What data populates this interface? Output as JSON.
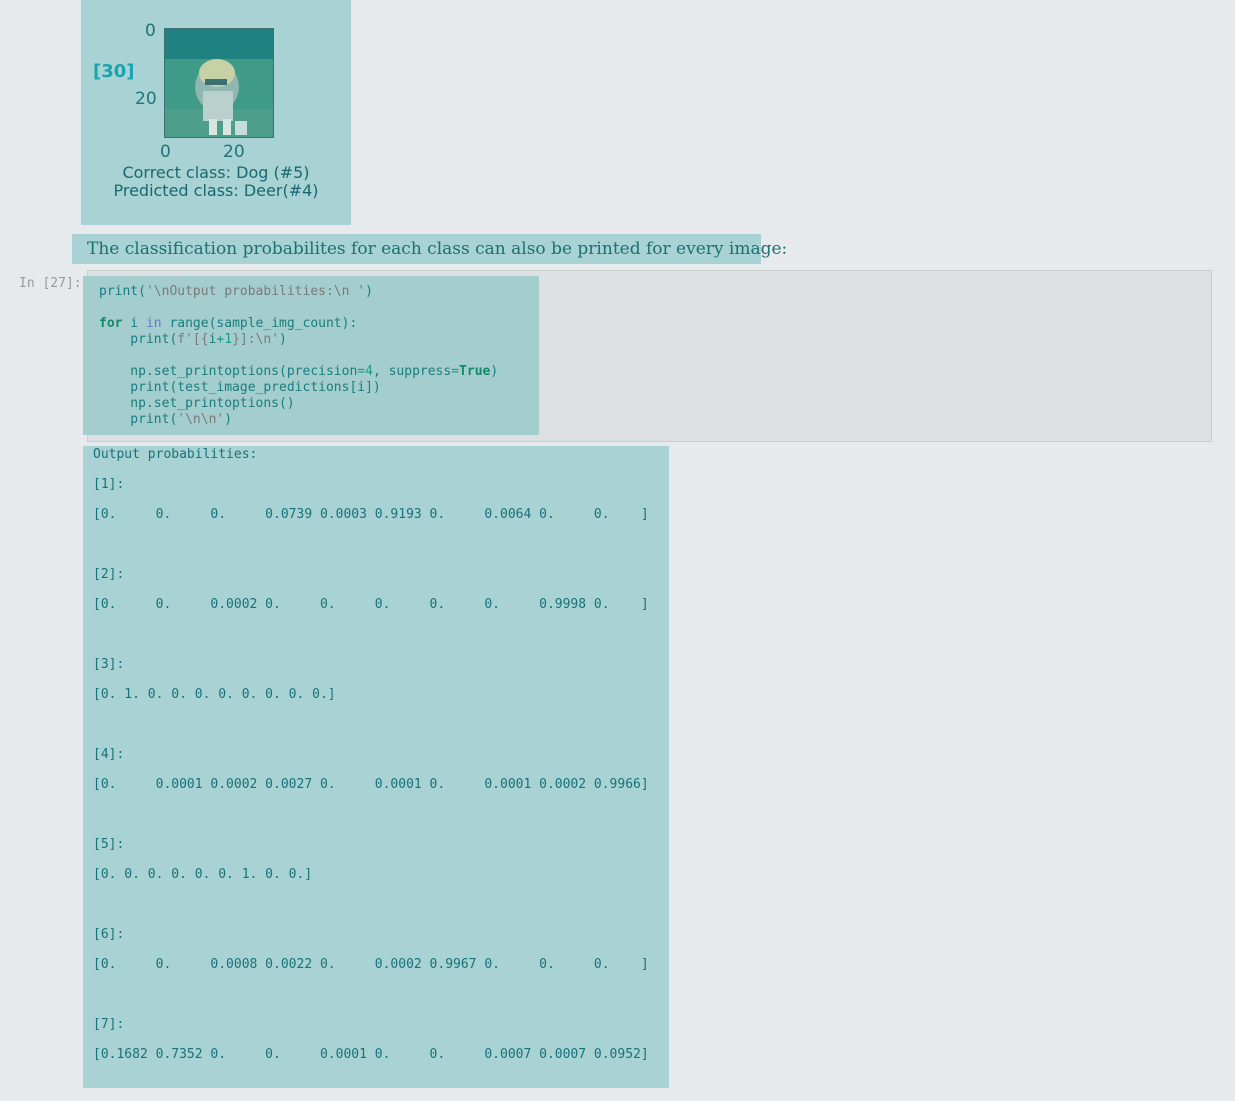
{
  "plot": {
    "label": "[30]",
    "y_ticks": [
      "0",
      "20"
    ],
    "x_ticks": [
      "0",
      "20"
    ],
    "correct": "Correct class: Dog (#5)",
    "predicted": "Predicted class: Deer(#4)"
  },
  "markdown": {
    "text": "The classification probabilites for each class can also be printed for every image:"
  },
  "cell": {
    "prompt": "In [27]:"
  },
  "output": {
    "text": "Output probabilities:\n\n[1]:\n\n[0.     0.     0.     0.0739 0.0003 0.9193 0.     0.0064 0.     0.    ]\n\n\n\n[2]:\n\n[0.     0.     0.0002 0.     0.     0.     0.     0.     0.9998 0.    ]\n\n\n\n[3]:\n\n[0. 1. 0. 0. 0. 0. 0. 0. 0. 0.]\n\n\n\n[4]:\n\n[0.     0.0001 0.0002 0.0027 0.     0.0001 0.     0.0001 0.0002 0.9966]\n\n\n\n[5]:\n\n[0. 0. 0. 0. 0. 0. 1. 0. 0.]\n\n\n\n[6]:\n\n[0.     0.     0.0008 0.0022 0.     0.0002 0.9967 0.     0.     0.    ]\n\n\n\n[7]:\n\n[0.1682 0.7352 0.     0.     0.0001 0.     0.     0.0007 0.0007 0.0952]"
  }
}
